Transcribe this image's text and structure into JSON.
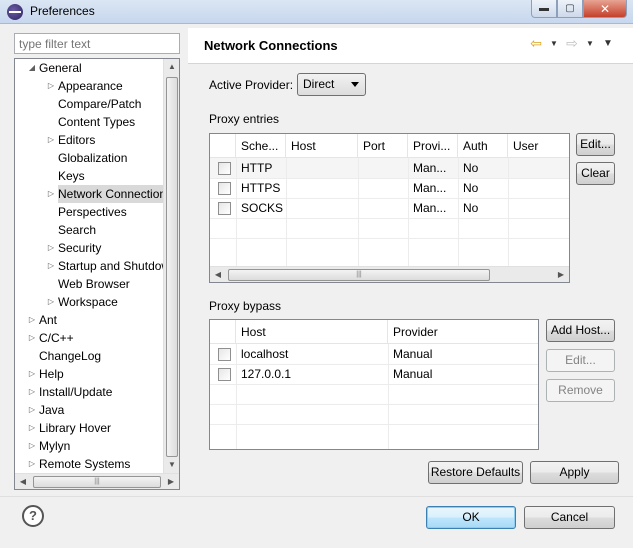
{
  "window": {
    "title": "Preferences",
    "minimize": "▬",
    "maximize": "▢",
    "close": "✕"
  },
  "filter": {
    "placeholder": "type filter text"
  },
  "tree": {
    "items": [
      {
        "label": "General",
        "twisty": "◢",
        "indent": 1
      },
      {
        "label": "Appearance",
        "twisty": "▷",
        "indent": 2
      },
      {
        "label": "Compare/Patch",
        "twisty": "",
        "indent": 2
      },
      {
        "label": "Content Types",
        "twisty": "",
        "indent": 2
      },
      {
        "label": "Editors",
        "twisty": "▷",
        "indent": 2
      },
      {
        "label": "Globalization",
        "twisty": "",
        "indent": 2
      },
      {
        "label": "Keys",
        "twisty": "",
        "indent": 2
      },
      {
        "label": "Network Connection",
        "twisty": "▷",
        "indent": 2,
        "selected": true
      },
      {
        "label": "Perspectives",
        "twisty": "",
        "indent": 2
      },
      {
        "label": "Search",
        "twisty": "",
        "indent": 2
      },
      {
        "label": "Security",
        "twisty": "▷",
        "indent": 2
      },
      {
        "label": "Startup and Shutdow",
        "twisty": "▷",
        "indent": 2
      },
      {
        "label": "Web Browser",
        "twisty": "",
        "indent": 2
      },
      {
        "label": "Workspace",
        "twisty": "▷",
        "indent": 2
      },
      {
        "label": "Ant",
        "twisty": "▷",
        "indent": 1
      },
      {
        "label": "C/C++",
        "twisty": "▷",
        "indent": 1
      },
      {
        "label": "ChangeLog",
        "twisty": "",
        "indent": 1
      },
      {
        "label": "Help",
        "twisty": "▷",
        "indent": 1
      },
      {
        "label": "Install/Update",
        "twisty": "▷",
        "indent": 1
      },
      {
        "label": "Java",
        "twisty": "▷",
        "indent": 1
      },
      {
        "label": "Library Hover",
        "twisty": "▷",
        "indent": 1
      },
      {
        "label": "Mylyn",
        "twisty": "▷",
        "indent": 1
      },
      {
        "label": "Remote Systems",
        "twisty": "▷",
        "indent": 1
      }
    ]
  },
  "scroll": {
    "up": "▲",
    "down": "▼",
    "left": "◀",
    "right": "▶",
    "grip": "|||"
  },
  "page": {
    "title": "Network Connections",
    "nav": {
      "back": "⇦",
      "forward": "⇨",
      "caret": "▼",
      "menu": "▼"
    }
  },
  "active_provider": {
    "label": "Active Provider:",
    "value": "Direct"
  },
  "proxy_entries": {
    "label": "Proxy entries",
    "columns": [
      "",
      "Sche...",
      "Host",
      "Port",
      "Provi...",
      "Auth",
      "User"
    ],
    "rows": [
      {
        "scheme": "HTTP",
        "host": "",
        "port": "",
        "provider": "Man...",
        "auth": "No",
        "user": ""
      },
      {
        "scheme": "HTTPS",
        "host": "",
        "port": "",
        "provider": "Man...",
        "auth": "No",
        "user": ""
      },
      {
        "scheme": "SOCKS",
        "host": "",
        "port": "",
        "provider": "Man...",
        "auth": "No",
        "user": ""
      }
    ],
    "edit_button": "Edit...",
    "clear_button": "Clear"
  },
  "proxy_bypass": {
    "label": "Proxy bypass",
    "columns": [
      "",
      "Host",
      "Provider"
    ],
    "rows": [
      {
        "host": "localhost",
        "provider": "Manual"
      },
      {
        "host": "127.0.0.1",
        "provider": "Manual"
      }
    ],
    "add_host_button": "Add Host...",
    "edit_button": "Edit...",
    "remove_button": "Remove"
  },
  "buttons": {
    "restore_defaults": "Restore Defaults",
    "apply": "Apply",
    "ok": "OK",
    "cancel": "Cancel"
  },
  "help": {
    "glyph": "?"
  }
}
